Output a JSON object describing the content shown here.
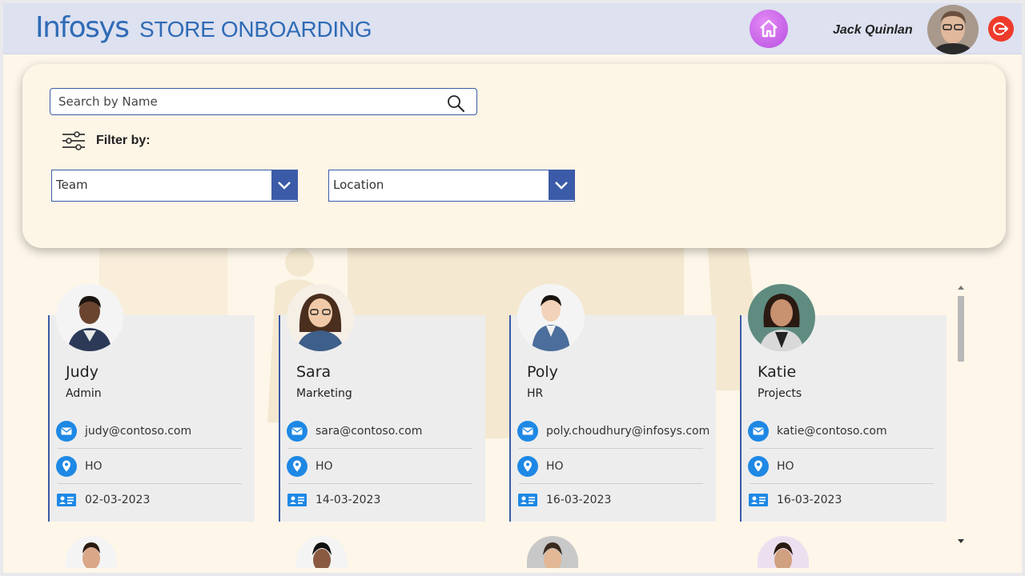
{
  "header": {
    "logo_text": "Infosys",
    "app_title": "STORE ONBOARDING",
    "user_name": "Jack Quinlan"
  },
  "search": {
    "placeholder": "Search by Name",
    "value": ""
  },
  "filter": {
    "label": "Filter by:",
    "team_dropdown": "Team",
    "location_dropdown": "Location"
  },
  "cards": [
    {
      "name": "Judy",
      "team": "Admin",
      "email": "judy@contoso.com",
      "location": "HO",
      "date": "02-03-2023"
    },
    {
      "name": "Sara",
      "team": "Marketing",
      "email": "sara@contoso.com",
      "location": "HO",
      "date": "14-03-2023"
    },
    {
      "name": "Poly",
      "team": "HR",
      "email": "poly.choudhury@infosys.com",
      "location": "HO",
      "date": "16-03-2023"
    },
    {
      "name": "Katie",
      "team": "Projects",
      "email": "katie@contoso.com",
      "location": "HO",
      "date": "16-03-2023"
    }
  ],
  "colors": {
    "accent": "#3b5ba8",
    "header_bg": "#dde1f0",
    "page_bg": "#fdf6e9",
    "home_button": "#c65ae6",
    "logout_button": "#ee3a2a",
    "icon_blue": "#1e88e5"
  },
  "icons": {
    "home": "home-icon",
    "logout": "logout-icon",
    "search": "search-icon",
    "filter": "sliders-icon",
    "email": "email-icon",
    "location": "location-pin-icon",
    "date": "id-card-icon"
  }
}
